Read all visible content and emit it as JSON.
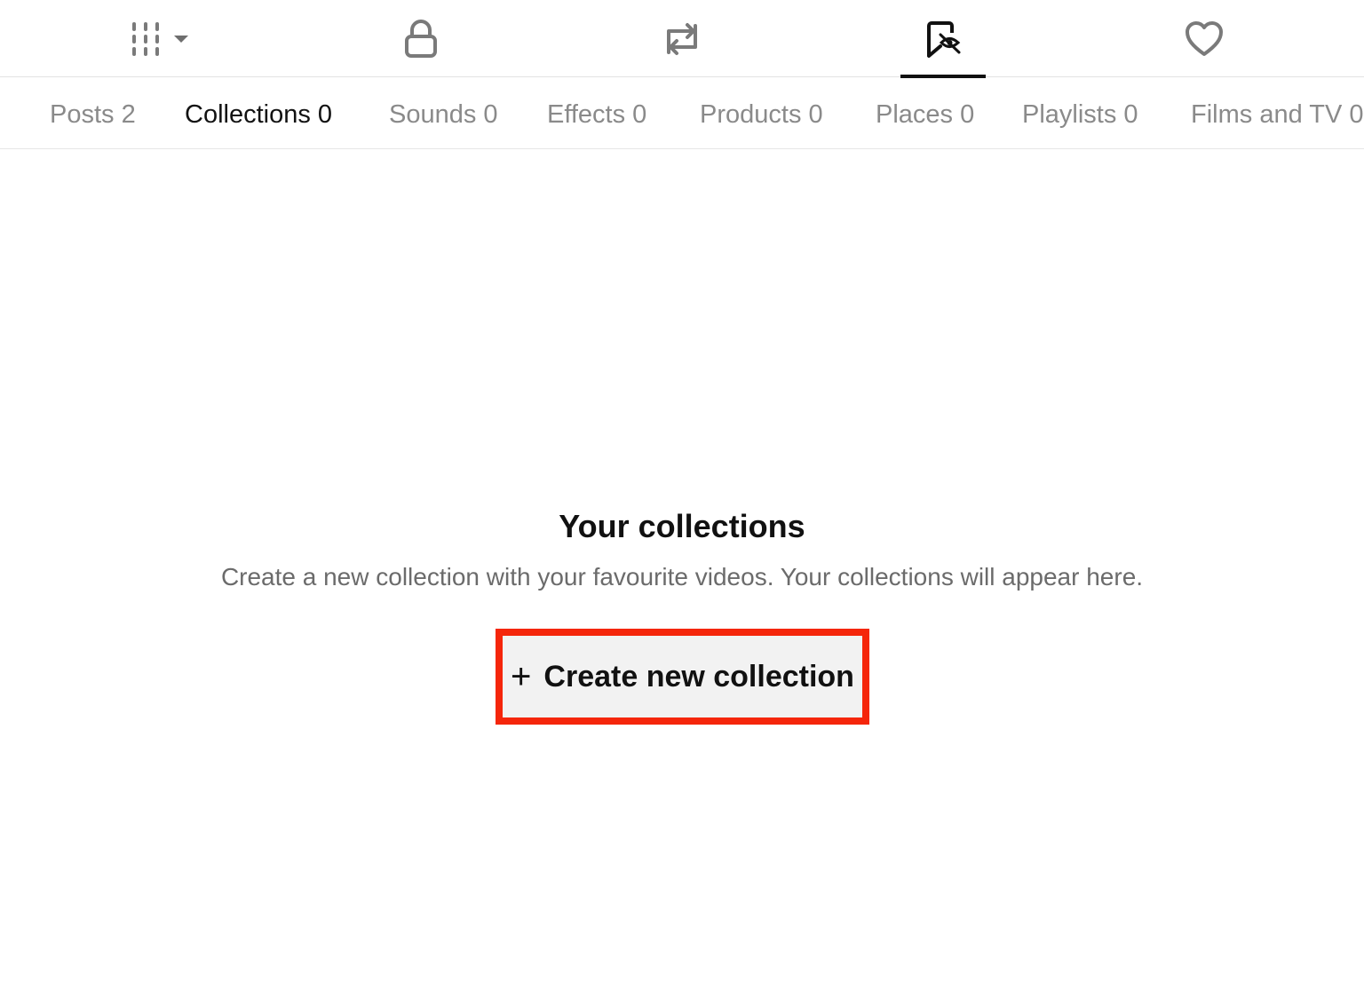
{
  "icon_tabs": [
    {
      "icon": "grid-filter-icon",
      "has_dropdown": true
    },
    {
      "icon": "lock-icon"
    },
    {
      "icon": "repost-icon"
    },
    {
      "icon": "bookmark-hidden-icon",
      "active": true
    },
    {
      "icon": "heart-icon"
    }
  ],
  "sub_tabs": {
    "posts": "Posts 2",
    "collections": "Collections 0",
    "sounds": "Sounds 0",
    "effects": "Effects 0",
    "products": "Products 0",
    "places": "Places 0",
    "playlists": "Playlists 0",
    "films_tv": "Films and TV 0"
  },
  "active_sub_tab": "collections",
  "empty_state": {
    "title": "Your collections",
    "description": "Create a new collection with your favourite videos. Your collections will appear here.",
    "button_icon": "+",
    "button_label": "Create new collection"
  },
  "colors": {
    "highlight_border": "#f5260b",
    "button_bg": "#f2f2f2",
    "active_text": "#121212",
    "inactive_text": "#8a8a8a"
  }
}
